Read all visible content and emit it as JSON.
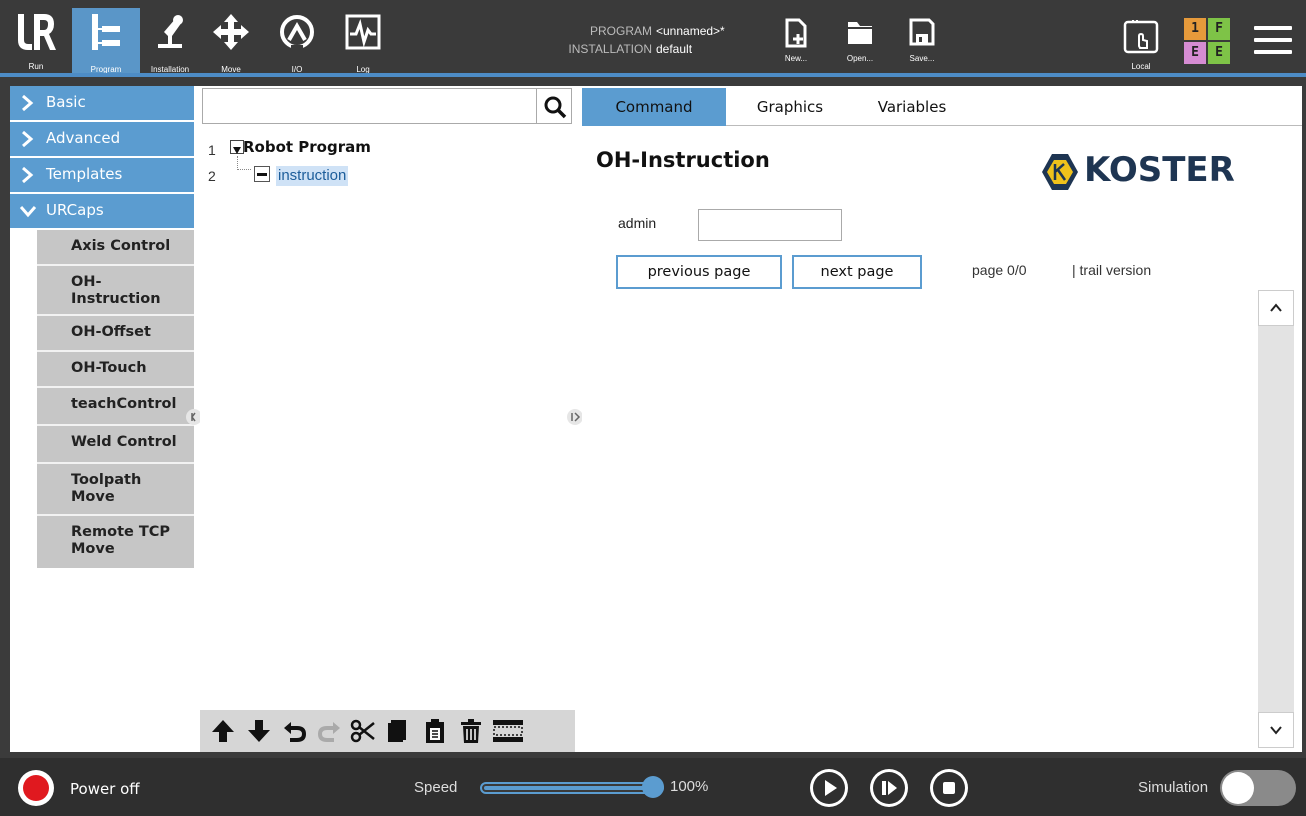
{
  "topbar": {
    "logo_caption": "Run",
    "nav": [
      {
        "label": "Program",
        "icon": "program-icon",
        "active": true
      },
      {
        "label": "Installation",
        "icon": "installation-icon",
        "active": false
      },
      {
        "label": "Move",
        "icon": "move-icon",
        "active": false
      },
      {
        "label": "I/O",
        "icon": "io-icon",
        "active": false
      },
      {
        "label": "Log",
        "icon": "log-icon",
        "active": false
      }
    ],
    "program_label": "PROGRAM",
    "program_value": "<unnamed>*",
    "installation_label": "INSTALLATION",
    "installation_value": "default",
    "file_buttons": [
      {
        "label": "New...",
        "icon": "new-file-icon"
      },
      {
        "label": "Open...",
        "icon": "open-folder-icon"
      },
      {
        "label": "Save...",
        "icon": "save-disk-icon"
      }
    ],
    "local_label": "Local",
    "mode_grid": [
      "1",
      "F",
      "E",
      "E"
    ],
    "accent_color": "#4d8cc6"
  },
  "leftnav": {
    "categories": [
      {
        "label": "Basic",
        "expanded": false
      },
      {
        "label": "Advanced",
        "expanded": false
      },
      {
        "label": "Templates",
        "expanded": false
      },
      {
        "label": "URCaps",
        "expanded": true
      }
    ],
    "urcaps_items": [
      {
        "label": "Axis Control"
      },
      {
        "label": "OH-\nInstruction"
      },
      {
        "label": "OH-Offset"
      },
      {
        "label": "OH-Touch"
      },
      {
        "label": "teachControl"
      },
      {
        "label": "Weld Control"
      },
      {
        "label": "Toolpath\nMove"
      },
      {
        "label": "Remote TCP\nMove"
      }
    ]
  },
  "tree": {
    "search_value": "",
    "lines": [
      {
        "num": "1",
        "label": "Robot Program"
      },
      {
        "num": "2",
        "label": "instruction"
      }
    ],
    "toolbar_icons": [
      "move-up-icon",
      "move-down-icon",
      "undo-icon",
      "redo-icon",
      "cut-icon",
      "copy-icon",
      "paste-icon",
      "delete-icon",
      "suppress-icon"
    ]
  },
  "content": {
    "tabs": [
      {
        "label": "Command",
        "active": true
      },
      {
        "label": "Graphics",
        "active": false
      },
      {
        "label": "Variables",
        "active": false
      }
    ],
    "title": "OH-Instruction",
    "brand_name": "KOSTER",
    "admin_label": "admin",
    "admin_value": "",
    "prev_button": "previous page",
    "next_button": "next page",
    "page_info": "page 0/0",
    "version_info": "| trail version"
  },
  "bottombar": {
    "power_label": "Power off",
    "speed_label": "Speed",
    "speed_value": "100%",
    "speed_fraction": 1.0,
    "simulation_label": "Simulation",
    "simulation_on": false,
    "power_color": "#e0191f"
  }
}
